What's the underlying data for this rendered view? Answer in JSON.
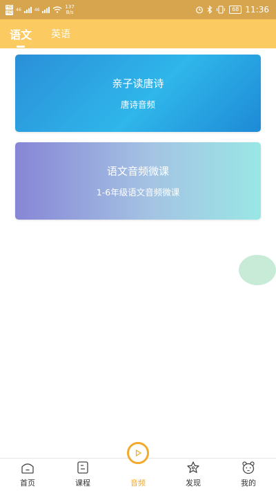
{
  "status_bar": {
    "hd1": "HD",
    "hd2": "HD",
    "net1": "46",
    "net2": "46",
    "speed_value": "137",
    "speed_unit": "B/s",
    "battery": "68",
    "time": "11:36"
  },
  "tabs": [
    {
      "label": "语文",
      "active": true
    },
    {
      "label": "英语",
      "active": false
    }
  ],
  "cards": [
    {
      "title": "亲子读唐诗",
      "subtitle": "唐诗音频"
    },
    {
      "title": "语文音频微课",
      "subtitle": "1-6年级语文音频微课"
    }
  ],
  "bottom_nav": [
    {
      "label": "首页",
      "icon": "home-icon"
    },
    {
      "label": "课程",
      "icon": "course-icon"
    },
    {
      "label": "音频",
      "icon": "audio-play-icon",
      "active": true
    },
    {
      "label": "发现",
      "icon": "discover-icon"
    },
    {
      "label": "我的",
      "icon": "profile-bear-icon"
    }
  ],
  "colors": {
    "status_bar": "#d8a54f",
    "header": "#fbcb62",
    "accent": "#f1aa2b",
    "float_bubble": "#c8ebd8"
  }
}
